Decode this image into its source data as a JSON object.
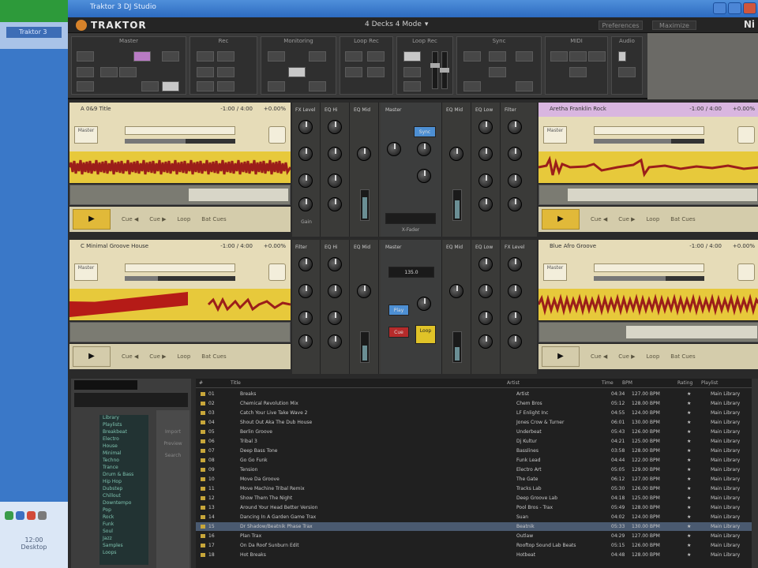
{
  "window": {
    "title": "Traktor 3 DJ Studio",
    "close": "✕"
  },
  "app": {
    "logo": "TRAKTOR",
    "ni": "Ni",
    "layout": "4 Decks 4 Mode",
    "btn1": "Preferences",
    "btn2": "Maximize"
  },
  "toolbar": {
    "sections": [
      "Master",
      "Rec",
      "Monitoring",
      "Loop Rec",
      "Loop Rec",
      "Sync",
      "MIDI",
      "Audio"
    ]
  },
  "decks": [
    {
      "id": "A",
      "title": "A 0&9 Title",
      "time": "-1:00 / 4:00",
      "bpm": "+0.00%",
      "mode": "Master",
      "cues": [
        "Cue ◀",
        "Cue ▶",
        "Loop",
        "Bat Cues"
      ],
      "progress": 0.55,
      "color": "#e6dcb8",
      "play": "▶"
    },
    {
      "id": "B",
      "title": "Aretha Franklin Rock",
      "time": "-1:00 / 4:00",
      "bpm": "+0.00%",
      "mode": "Master",
      "cues": [
        "Cue ◀",
        "Cue ▶",
        "Loop",
        "Bat Cues"
      ],
      "progress": 0.7,
      "color": "#d9b6e0",
      "play": "▶"
    },
    {
      "id": "C",
      "title": "C Minimal Groove House",
      "time": "-1:00 / 4:00",
      "bpm": "+0.00%",
      "mode": "Master",
      "cues": [
        "Cue ◀",
        "Cue ▶",
        "Loop",
        "Bat Cues"
      ],
      "progress": 0.3,
      "color": "#e6dcb8",
      "play": "▶"
    },
    {
      "id": "D",
      "title": "Blue Afro Groove",
      "time": "-1:00 / 4:00",
      "bpm": "+0.00%",
      "mode": "Master",
      "cues": [
        "Cue ◀",
        "Cue ▶",
        "Loop",
        "Bat Cues"
      ],
      "progress": 0.65,
      "color": "#e6dcb8",
      "play": "▶"
    }
  ],
  "mixer": {
    "channels": [
      "FX Level",
      "EQ Hi",
      "EQ Mid",
      "EQ Low",
      "Filter",
      "Gain"
    ],
    "center": {
      "limiter": "Master",
      "xfader": "X-Fader",
      "tempo": "135.0",
      "play": "Play",
      "cue": "Cue",
      "sync": "Sync",
      "loop": "Loop"
    }
  },
  "browser": {
    "columns": [
      "#",
      "Title",
      "Artist",
      "Time",
      "BPM",
      "Rating",
      "Playlist"
    ],
    "tree": [
      "Library",
      "Playlists",
      "Breakbeat",
      "Electro",
      "House",
      "Minimal",
      "Techno",
      "Trance",
      "Drum & Bass",
      "Hip Hop",
      "Dubstep",
      "Chillout",
      "Downtempo",
      "Pop",
      "Rock",
      "Funk",
      "Soul",
      "Jazz",
      "Samples",
      "Loops"
    ],
    "mid_labels": [
      "Import",
      "Preview",
      "Search"
    ],
    "rows": [
      {
        "n": "01",
        "title": "Breaks",
        "artist": "Artist",
        "time": "04:34",
        "bpm": "127.00 BPM",
        "rating": "★",
        "pl": "Main Library"
      },
      {
        "n": "02",
        "title": "Chemical Revolution Mix",
        "artist": "Chem Bros",
        "time": "05:12",
        "bpm": "128.00 BPM",
        "rating": "★",
        "pl": "Main Library"
      },
      {
        "n": "03",
        "title": "Catch Your Live Take Wave 2",
        "artist": "LF Enlight Inc",
        "time": "04:55",
        "bpm": "124.00 BPM",
        "rating": "★",
        "pl": "Main Library"
      },
      {
        "n": "04",
        "title": "Shout Out Aka The Dub House",
        "artist": "Jones Crow & Turner",
        "time": "06:01",
        "bpm": "130.00 BPM",
        "rating": "★",
        "pl": "Main Library"
      },
      {
        "n": "05",
        "title": "Berlin Groove",
        "artist": "Underbeat",
        "time": "05:43",
        "bpm": "126.00 BPM",
        "rating": "★",
        "pl": "Main Library"
      },
      {
        "n": "06",
        "title": "Tribal 3",
        "artist": "Dj Kultur",
        "time": "04:21",
        "bpm": "125.00 BPM",
        "rating": "★",
        "pl": "Main Library"
      },
      {
        "n": "07",
        "title": "Deep Bass Tone",
        "artist": "Basslines",
        "time": "03:58",
        "bpm": "128.00 BPM",
        "rating": "★",
        "pl": "Main Library"
      },
      {
        "n": "08",
        "title": "Go Go Funk",
        "artist": "Funk Lead",
        "time": "04:44",
        "bpm": "122.00 BPM",
        "rating": "★",
        "pl": "Main Library"
      },
      {
        "n": "09",
        "title": "Tension",
        "artist": "Electro Art",
        "time": "05:05",
        "bpm": "129.00 BPM",
        "rating": "★",
        "pl": "Main Library"
      },
      {
        "n": "10",
        "title": "Move Da Groove",
        "artist": "The Gate",
        "time": "06:12",
        "bpm": "127.00 BPM",
        "rating": "★",
        "pl": "Main Library"
      },
      {
        "n": "11",
        "title": "Move Machine Tribal Remix",
        "artist": "Tracks Lab",
        "time": "05:30",
        "bpm": "126.00 BPM",
        "rating": "★",
        "pl": "Main Library"
      },
      {
        "n": "12",
        "title": "Show Them The Night",
        "artist": "Deep Groove Lab",
        "time": "04:18",
        "bpm": "125.00 BPM",
        "rating": "★",
        "pl": "Main Library"
      },
      {
        "n": "13",
        "title": "Around Your Head Better Version",
        "artist": "Pool Bros - Trax",
        "time": "05:49",
        "bpm": "128.00 BPM",
        "rating": "★",
        "pl": "Main Library"
      },
      {
        "n": "14",
        "title": "Dancing In A Garden Game Trax",
        "artist": "Suan",
        "time": "04:02",
        "bpm": "124.00 BPM",
        "rating": "★",
        "pl": "Main Library"
      },
      {
        "n": "15",
        "title": "Dr Shadow/Beatnik Phase Trax",
        "artist": "Beatnik",
        "time": "05:33",
        "bpm": "130.00 BPM",
        "rating": "★",
        "pl": "Main Library"
      },
      {
        "n": "16",
        "title": "Plan Trax",
        "artist": "Outlaw",
        "time": "04:29",
        "bpm": "127.00 BPM",
        "rating": "★",
        "pl": "Main Library"
      },
      {
        "n": "17",
        "title": "On Da Roof Sunburn Edit",
        "artist": "Rooftop Sound Lab Beats",
        "time": "05:15",
        "bpm": "126.00 BPM",
        "rating": "★",
        "pl": "Main Library"
      },
      {
        "n": "18",
        "title": "Hot Breaks",
        "artist": "Hotbeat",
        "time": "04:48",
        "bpm": "128.00 BPM",
        "rating": "★",
        "pl": "Main Library"
      }
    ]
  },
  "os": {
    "sidebar_item": "Traktor 3",
    "time": "12:00",
    "date": "Desktop"
  },
  "colors": {
    "wave_bg": "#e7c93b",
    "wave_fg": "#9b1e1a",
    "deck_bg": "#e6dcb8",
    "accent": "#d6822a"
  }
}
